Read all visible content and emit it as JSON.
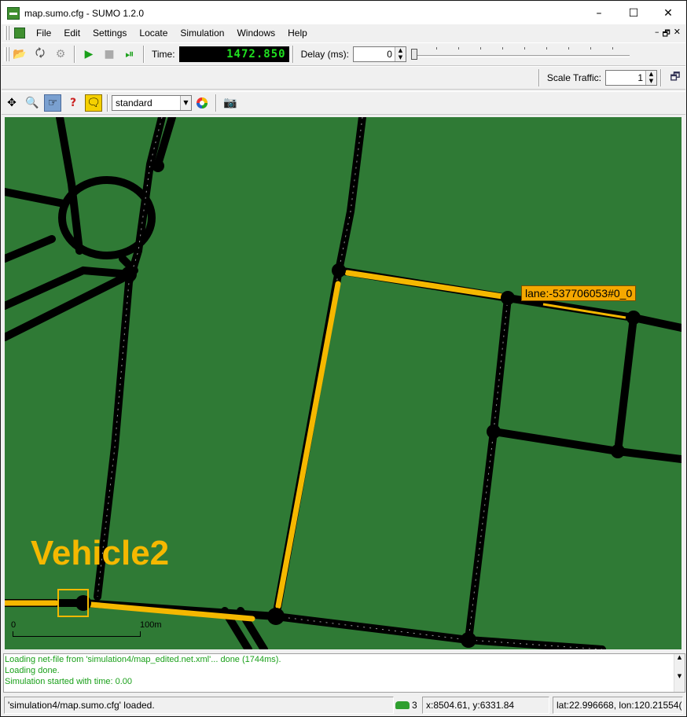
{
  "window": {
    "title": "map.sumo.cfg - SUMO 1.2.0",
    "minimize": "–",
    "maximize": "☐",
    "close": "✕"
  },
  "menu": {
    "items": [
      "File",
      "Edit",
      "Settings",
      "Locate",
      "Simulation",
      "Windows",
      "Help"
    ],
    "mdi": [
      "–",
      "🗗",
      "✕"
    ]
  },
  "toolbar": {
    "time_label": "Time:",
    "time_value": "1472.850",
    "delay_label": "Delay (ms):",
    "delay_value": "0",
    "scale_traffic_label": "Scale Traffic:",
    "scale_traffic_value": "1"
  },
  "view_toolbar": {
    "scheme": "standard"
  },
  "map": {
    "lane_tooltip": "lane:-537706053#0_0",
    "vehicle_annotation": "Vehicle2",
    "scale_start": "0",
    "scale_end": "100m",
    "colors": {
      "background": "#2f7a35",
      "road": "#000000",
      "highlight": "#f5b800"
    }
  },
  "log": {
    "lines": [
      "Loading net-file from 'simulation4/map_edited.net.xml'... done (1744ms).",
      "Loading done.",
      "Simulation started with time: 0.00"
    ]
  },
  "status": {
    "message": "'simulation4/map.sumo.cfg' loaded.",
    "vehicle_count": "3",
    "coords": "x:8504.61, y:6331.84",
    "geo": "lat:22.996668, lon:120.21554("
  }
}
